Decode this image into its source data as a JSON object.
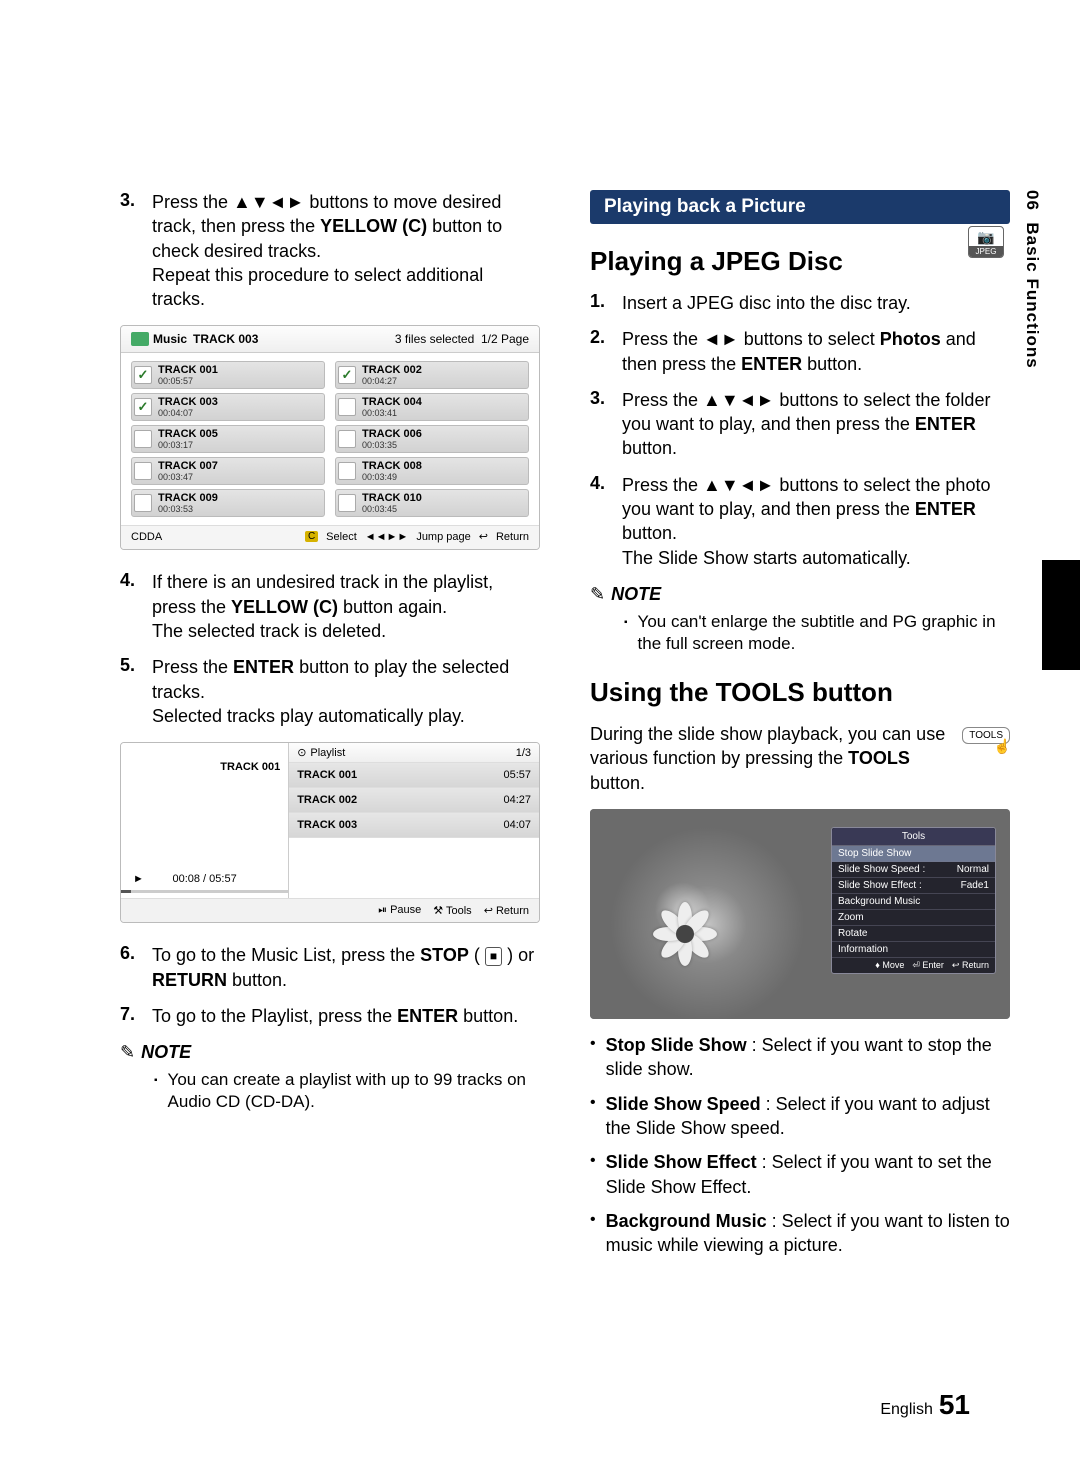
{
  "side": {
    "chapter": "06",
    "title": "Basic Functions"
  },
  "jpeg_badge": {
    "icon": "📷",
    "label": "JPEG"
  },
  "left": {
    "step3": {
      "num": "3.",
      "pre": "Press the ",
      "arrows": "▲▼◄►",
      "mid": " buttons to move desired track, then press the ",
      "btn": "YELLOW (C)",
      "post": " button to check desired tracks.",
      "line2": "Repeat this procedure to select additional tracks."
    },
    "music_scr": {
      "icon_label": "Music",
      "current": "TRACK 003",
      "right1": "3 files selected",
      "right2": "1/2 Page",
      "tracks": [
        {
          "name": "TRACK 001",
          "time": "00:05:57",
          "checked": true
        },
        {
          "name": "TRACK 002",
          "time": "00:04:27",
          "checked": true
        },
        {
          "name": "TRACK 003",
          "time": "00:04:07",
          "checked": true
        },
        {
          "name": "TRACK 004",
          "time": "00:03:41",
          "checked": false
        },
        {
          "name": "TRACK 005",
          "time": "00:03:17",
          "checked": false
        },
        {
          "name": "TRACK 006",
          "time": "00:03:35",
          "checked": false
        },
        {
          "name": "TRACK 007",
          "time": "00:03:47",
          "checked": false
        },
        {
          "name": "TRACK 008",
          "time": "00:03:49",
          "checked": false
        },
        {
          "name": "TRACK 009",
          "time": "00:03:53",
          "checked": false
        },
        {
          "name": "TRACK 010",
          "time": "00:03:45",
          "checked": false
        }
      ],
      "foot_left": "CDDA",
      "foot_select": "Select",
      "foot_jump": "Jump page",
      "foot_return": "Return"
    },
    "step4": {
      "num": "4.",
      "pre": "If there is an undesired track in the playlist, press the ",
      "btn": "YELLOW (C)",
      "post": " button again.",
      "line2": "The selected track is deleted."
    },
    "step5": {
      "num": "5.",
      "pre": "Press the ",
      "btn": "ENTER",
      "post": " button to play the selected tracks.",
      "line2": "Selected tracks play automatically play."
    },
    "playlist_scr": {
      "head_label": "Playlist",
      "head_page": "1/3",
      "now": "TRACK 001",
      "time": "00:08 / 05:57",
      "rows": [
        {
          "name": "TRACK 001",
          "dur": "05:57"
        },
        {
          "name": "TRACK 002",
          "dur": "04:27"
        },
        {
          "name": "TRACK 003",
          "dur": "04:07"
        }
      ],
      "foot_pause": "Pause",
      "foot_tools": "Tools",
      "foot_return": "Return"
    },
    "step6": {
      "num": "6.",
      "pre": "To go to the Music List, press the ",
      "btn": "STOP",
      "stop_glyph": "■",
      "mid": " or ",
      "btn2": "RETURN",
      "post": " button."
    },
    "step7": {
      "num": "7.",
      "pre": "To go to the Playlist, press the ",
      "btn": "ENTER",
      "post": " button."
    },
    "note_label": "NOTE",
    "note1": "You can create a playlist with up to 99 tracks on Audio CD (CD-DA)."
  },
  "right": {
    "bar": "Playing back a Picture",
    "h_jpeg": "Playing a JPEG Disc",
    "j1": {
      "num": "1.",
      "text": "Insert a JPEG disc into the disc tray."
    },
    "j2": {
      "num": "2.",
      "pre": "Press the ",
      "arrows": "◄►",
      "mid": " buttons to select ",
      "bold": "Photos",
      "mid2": " and then press the ",
      "btn": "ENTER",
      "post": " button."
    },
    "j3": {
      "num": "3.",
      "pre": "Press the ",
      "arrows": "▲▼◄►",
      "mid": " buttons to select the folder you want to play, and then press the ",
      "btn": "ENTER",
      "post": " button."
    },
    "j4": {
      "num": "4.",
      "pre": "Press the ",
      "arrows": "▲▼◄►",
      "mid": " buttons to select the photo you want to play, and then press the ",
      "btn": "ENTER",
      "post": " button.",
      "line2": "The Slide Show starts automatically."
    },
    "note_label": "NOTE",
    "note1": "You can't enlarge the subtitle and PG graphic in the full screen mode.",
    "h_tools": "Using the TOOLS button",
    "tools_para_pre": "During the slide show playback, you can use various function by pressing the ",
    "tools_para_btn": "TOOLS",
    "tools_para_post": " button.",
    "tools_badge": "TOOLS",
    "tools_scr": {
      "title": "Tools",
      "rows": [
        {
          "l": "Stop Slide Show",
          "r": ""
        },
        {
          "l": "Slide Show Speed  :",
          "r": "Normal"
        },
        {
          "l": "Slide Show Effect  :",
          "r": "Fade1"
        },
        {
          "l": "Background Music",
          "r": ""
        },
        {
          "l": "Zoom",
          "r": ""
        },
        {
          "l": "Rotate",
          "r": ""
        },
        {
          "l": "Information",
          "r": ""
        }
      ],
      "foot_move": "Move",
      "foot_enter": "Enter",
      "foot_return": "Return"
    },
    "bullets": [
      {
        "b": "Stop Slide Show",
        "t": " : Select if you want to stop the slide show."
      },
      {
        "b": "Slide Show Speed",
        "t": " : Select if you want to adjust the Slide Show speed."
      },
      {
        "b": "Slide Show Effect",
        "t": " : Select if you want to set the Slide Show Effect."
      },
      {
        "b": "Background Music",
        "t": " : Select if you want to listen to music while viewing a picture."
      }
    ]
  },
  "footer": {
    "lang": "English",
    "page": "51"
  }
}
